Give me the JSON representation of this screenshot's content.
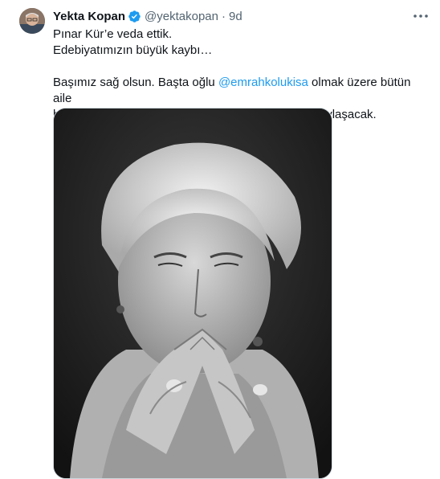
{
  "tweet": {
    "author_name": "Yekta Kopan",
    "handle": "@yektakopan",
    "separator": "·",
    "time": "9d",
    "verified": true,
    "line1": "Pınar Kür’e veda ettik.",
    "line2": "Edebiyatımızın büyük kaybı…",
    "line3_prefix": "Başımız sağ olsun. Başta oğlu ",
    "mention": "@emrahkolukisa",
    "line3_suffix": " olmak üzere bütün aile",
    "line4": "büyük üzüntü içinde. Cenaze ile ilgili bilgileri aile paylaşacak."
  },
  "icons": {
    "verified": "verified-badge-icon",
    "more": "more-horizontal-icon"
  },
  "colors": {
    "link": "#1d9bf0",
    "secondary_text": "#536471",
    "primary_text": "#0f1419"
  }
}
